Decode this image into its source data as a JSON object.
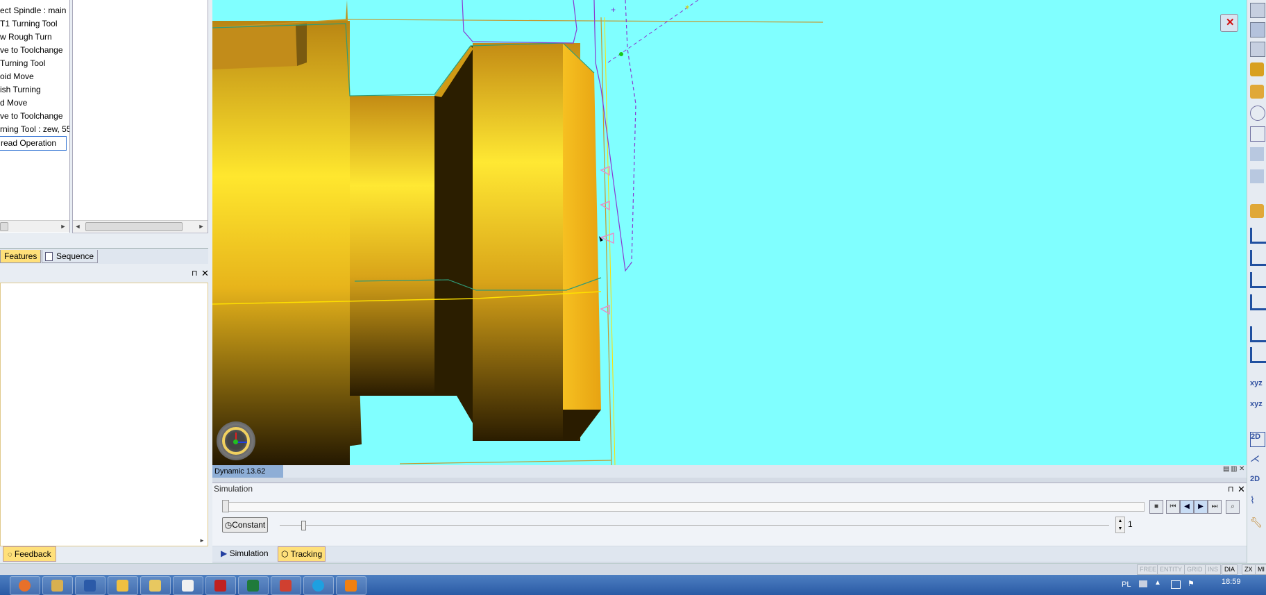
{
  "operations_tree": {
    "items": [
      "ect Spindle : main",
      "T1 Turning Tool",
      "w Rough Turn",
      "ve to Toolchange",
      "Turning Tool",
      "oid Move",
      "ish Turning",
      "d Move",
      "ve to Toolchange",
      "rning Tool : zew, 55",
      "read Operation"
    ],
    "selected_index": 10
  },
  "manager_tabs": {
    "features": "Features",
    "sequence": "Sequence"
  },
  "feedback_tab": "Feedback",
  "viewport": {
    "background": "#80ffff",
    "part_color": "#f5c21a",
    "status_label": "Dynamic 13.62"
  },
  "simulation": {
    "title": "Simulation",
    "constant_label": "Constant",
    "speed_value": "1",
    "progress": 0.0
  },
  "bottom_tabs": {
    "simulation": "Simulation",
    "tracking": "Tracking"
  },
  "mode_indicators": [
    "FREE",
    "ENTITY",
    "GRID",
    "INS",
    "DIA",
    "ZX",
    "MI"
  ],
  "mode_indicators_active": [
    "DIA",
    "ZX",
    "MI"
  ],
  "taskbar": {
    "apps": [
      "firefox-icon",
      "tools-icon",
      "word-icon",
      "folder-icon",
      "explorer-icon",
      "browser-icon",
      "pdf-icon",
      "excel-icon",
      "cad-icon",
      "skype-icon",
      "vlc-icon"
    ],
    "language": "PL",
    "clock": "18:59"
  }
}
